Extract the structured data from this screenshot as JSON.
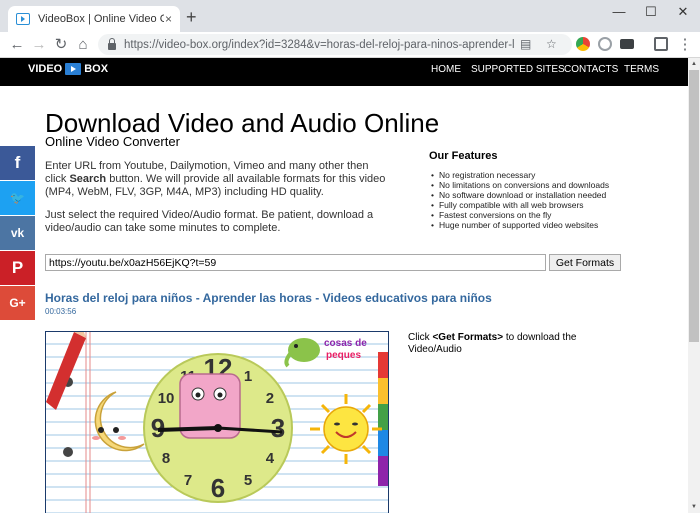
{
  "browser": {
    "tab_title": "VideoBox | Online Video Conve",
    "tab_close": "×",
    "new_tab": "+",
    "url": "https://video-box.org/index?id=3284&v=horas-del-reloj-para-ninos-aprender-l..."
  },
  "site": {
    "logo_left": "VIDEO",
    "logo_right": "BOX",
    "nav": [
      "HOME",
      "SUPPORTED SITES",
      "CONTACTS",
      "TERMS"
    ],
    "heading": "Download Video and Audio Online",
    "subheading": "Online Video Converter",
    "intro_before": "Enter URL from Youtube, Dailymotion, Vimeo and many other then click ",
    "intro_bold": "Search",
    "intro_after": " button. We will provide all available formats for this video (MP4, WebM, FLV, 3GP, M4A, MP3) including HD quality.",
    "intro2": "Just select the required Video/Audio format. Be patient, download a video/audio can take some minutes to complete.",
    "features_title": "Our Features",
    "features": [
      "No registration necessary",
      "No limitations on conversions and downloads",
      "No software download or installation needed",
      "Fully compatible with all web browsers",
      "Fastest conversions on the fly",
      "Huge number of supported video websites"
    ],
    "url_value": "https://youtu.be/x0azH56EjKQ?t=59",
    "get_formats_label": "Get Formats",
    "video_title": "Horas del reloj para niños - Aprender las horas - Videos educativos para niños",
    "video_duration": "00:03:56",
    "click_before": "Click ",
    "click_bold": "<Get Formats>",
    "click_after": " to download the Video/Audio",
    "thumb_logo_line1": "cosas de",
    "thumb_logo_line2": "peques"
  },
  "social_icons": [
    {
      "name": "facebook-icon",
      "glyph": "f",
      "color": "#3b5998"
    },
    {
      "name": "twitter-icon",
      "glyph": "🐦",
      "color": "#1da1f2"
    },
    {
      "name": "vk-icon",
      "glyph": "vk",
      "color": "#4c75a3"
    },
    {
      "name": "pinterest-icon",
      "glyph": "P",
      "color": "#cb2027"
    },
    {
      "name": "google-plus-icon",
      "glyph": "G+",
      "color": "#dd4b39"
    }
  ],
  "clock_numbers": [
    "12",
    "1",
    "2",
    "3",
    "4",
    "5",
    "6",
    "7",
    "8",
    "9",
    "10",
    "11"
  ]
}
